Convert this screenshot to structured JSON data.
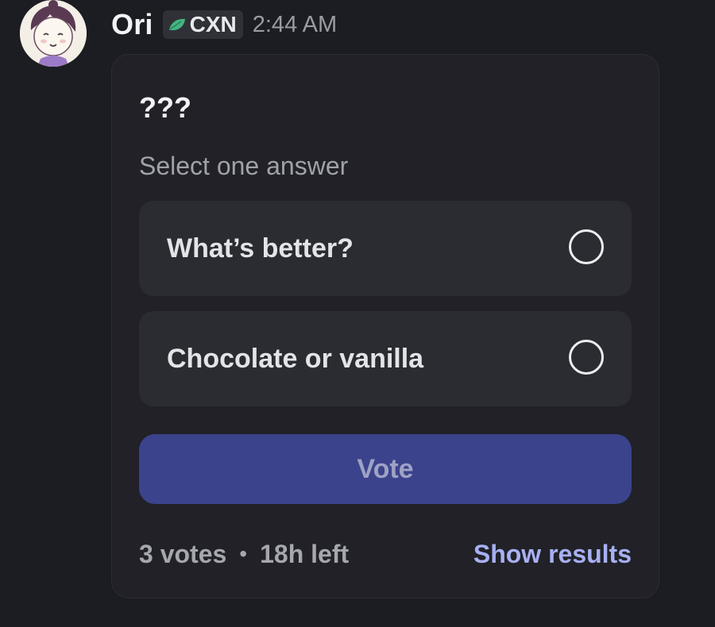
{
  "message": {
    "author": "Ori",
    "tag": {
      "icon": "leaf-icon",
      "text": "CXN",
      "color": "#43b581"
    },
    "timestamp": "2:44 AM"
  },
  "poll": {
    "question": "???",
    "hint": "Select one answer",
    "answers": [
      {
        "label": "What’s better?",
        "selected": false
      },
      {
        "label": "Chocolate or vanilla",
        "selected": false
      }
    ],
    "vote_label": "Vote",
    "votes": "3 votes",
    "separator": "•",
    "time_left": "18h left",
    "show_results_label": "Show results"
  },
  "colors": {
    "background": "#1c1d22",
    "card": "#212127",
    "answer_bg": "#2b2c32",
    "vote_button": "#3b438c",
    "link": "#a8b0f2"
  }
}
